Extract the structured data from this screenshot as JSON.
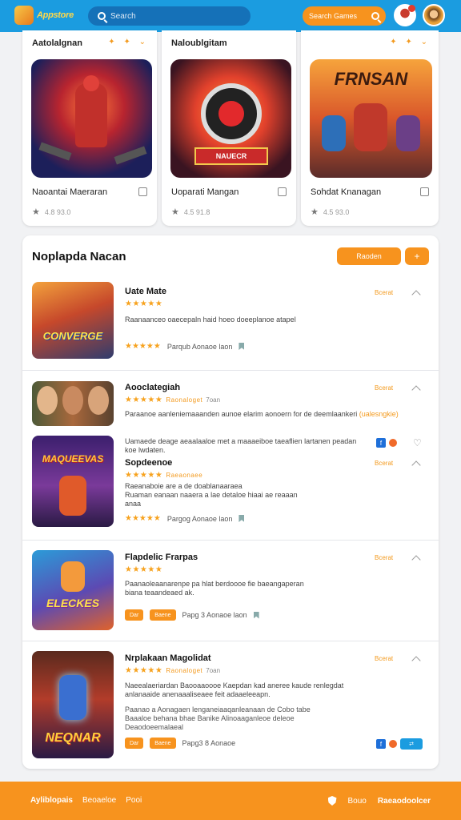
{
  "header": {
    "logo_text": "Appstore",
    "search_text": "Search",
    "promo_search_text": "Search Games",
    "accent": "#1b9ce0",
    "orange": "#f7931e"
  },
  "top_cards": [
    {
      "heading": "Aatolalgnan",
      "title": "Naoantai Maeraran",
      "meta": "4.8 93.0",
      "art": "robot-warrior"
    },
    {
      "heading": "Naloublgitam",
      "title": "Uoparati Mangan",
      "meta": "4.5 91.8",
      "art": "target-drone"
    },
    {
      "heading": "",
      "title": "Sohdat Knanagan",
      "meta": "4.5 93.0",
      "art": "squad-heroes",
      "art_title": "FRNSAN"
    }
  ],
  "panel": {
    "title": "Noplapda Nacan",
    "button_label": "Raoden",
    "button2_label": "+"
  },
  "rows": [
    {
      "title": "Uate Mate",
      "stars": "★★★★★",
      "desc": "Raanaanceo oaecepaln haid hoeo doeeplanoe atapel",
      "foot_stars": "★★★★★",
      "foot_text": "Parqub Aonaoe laon",
      "tag": "Bcerat",
      "art_title": "CONVERGE"
    },
    {
      "title": "Aooclategiah",
      "stars": "★★★★★",
      "stars_extra": "Raonaloget",
      "stars_note": "7oan",
      "desc": "Paraanoe aanleniemaaanden aunoe elarim aonoern for de deemlaankeri",
      "desc_tag": "(ualesngkie)",
      "tag": "Bcerat",
      "art_title": ""
    },
    {
      "title": "Sopdeenoe",
      "intro": "Uamaede deage aeaalaaloe met a maaaeiboe taeaflien lartanen peadan koe lwdaten.",
      "stars": "★★★★★",
      "stars_extra": "Raeaonaee",
      "desc": "Raeanaboie are a de doablanaaraea\nRuaman eanaan naaera a lae detaloe hiaai ae reaaan\nanaa",
      "foot_stars": "★★★★★",
      "foot_text": "Pargog Aonaoe laon",
      "tag": "Bcerat",
      "art_title": "MAQUEEVAS"
    },
    {
      "title": "Flapdelic Frarpas",
      "stars": "★★★★★",
      "desc": "Paanaoleaanarenpe pa hlat berdoooe fie baeangaperan\nbiana teaandeaed ak.",
      "pill1": "Dar",
      "pill2": "Baene",
      "foot_text": "Papg 3 Aonaoe laon",
      "tag": "Bcerat",
      "art_title": "ELECKES"
    },
    {
      "title": "Nrplakaan Magolidat",
      "stars": "★★★★★",
      "stars_extra": "Raonaloget",
      "stars_note": "7oan",
      "desc": "Naeealaeriardan Baooaaoooe Kaepdan kad aneree kaude renlegdat\nanlanaaide anenaaaliseaee feit adaaeleeapn.",
      "desc2": "Paanao a Aonagaen lenganeiaaqanleanaan de Cobo tabe\nBaaaloe behana bhae Banike Alinoaaganleoe deleoe\nDeaodoeemalaeal",
      "pill1": "Dar",
      "pill2": "Baene",
      "foot_text": "Papg3 8 Aonaoe",
      "tag": "Bcerat",
      "art_title": "NEQNAR"
    }
  ],
  "footer": {
    "left_bold": "Ayliblopais",
    "left_2": "Beoaeloe",
    "left_3": "Pooi",
    "right_1": "Bouo",
    "right_2": "Raeaodoolcer"
  }
}
